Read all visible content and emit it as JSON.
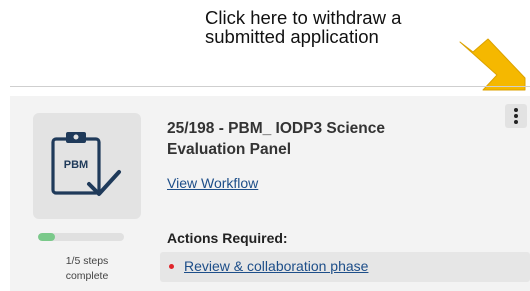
{
  "callout": {
    "lines": [
      "Click here to withdraw a",
      "submitted application"
    ]
  },
  "card": {
    "title": "25/198 - PBM_ IODP3 Science Evaluation Panel",
    "view_workflow_label": "View Workflow",
    "thumbnail_text": "PBM",
    "progress": {
      "fraction": 0.2,
      "steps_line1": "1/5 steps",
      "steps_line2": "complete"
    },
    "actions_heading": "Actions Required:",
    "actions": [
      "Review & collaboration phase"
    ]
  },
  "icons": {
    "thumbnail": "clipboard-check-icon",
    "menu": "kebab-menu-icon",
    "pointer": "arrow-pointer-icon",
    "bullet": "bullet-dot-icon"
  },
  "colors": {
    "arrow": "#f5b800",
    "progress": "#7ac98a",
    "bullet": "#e0242a",
    "link": "#1d4e89",
    "icon": "#1f3a5a"
  }
}
